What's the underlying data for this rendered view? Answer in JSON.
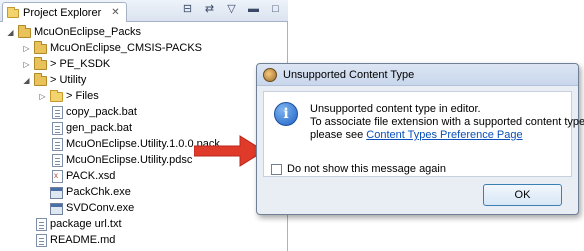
{
  "explorer": {
    "tab_title": "Project Explorer",
    "close_glyph": "✕",
    "toolbar_icons": [
      "collapse-all-icon",
      "link-with-editor-icon",
      "view-menu-icon",
      "minimize-icon",
      "maximize-icon"
    ],
    "items": [
      {
        "label": "McuOnEclipse_Packs",
        "icon": "project-icon",
        "expanded": true
      },
      {
        "label": "McuOnEclipse_CMSIS-PACKS",
        "icon": "project-icon",
        "expanded": false
      },
      {
        "label": "> PE_KSDK",
        "icon": "project-icon",
        "expanded": false
      },
      {
        "label": "> Utility",
        "icon": "project-icon",
        "expanded": true
      },
      {
        "label": "> Files",
        "icon": "folder-icon",
        "expanded": false
      },
      {
        "label": "copy_pack.bat",
        "icon": "file-icon"
      },
      {
        "label": "gen_pack.bat",
        "icon": "file-icon"
      },
      {
        "label": "McuOnEclipse.Utility.1.0.0.pack",
        "icon": "file-icon"
      },
      {
        "label": "McuOnEclipse.Utility.pdsc",
        "icon": "file-icon"
      },
      {
        "label": "PACK.xsd",
        "icon": "xsd-icon"
      },
      {
        "label": "PackChk.exe",
        "icon": "exe-icon"
      },
      {
        "label": "SVDConv.exe",
        "icon": "exe-icon"
      },
      {
        "label": "package url.txt",
        "icon": "file-icon"
      },
      {
        "label": "README.md",
        "icon": "file-icon"
      }
    ]
  },
  "dialog": {
    "title": "Unsupported Content Type",
    "message_line1": "Unsupported content type in editor.",
    "message_line2": "To associate file extension with a supported content type,",
    "message_line3_prefix": "please see ",
    "link_text": "Content Types Preference Page",
    "checkbox_label": "Do not show this message again",
    "checkbox_checked": false,
    "ok_label": "OK"
  },
  "colors": {
    "arrow": "#e03a2a",
    "link": "#0a4fb8",
    "dialog_bg": "#e9eef5"
  }
}
